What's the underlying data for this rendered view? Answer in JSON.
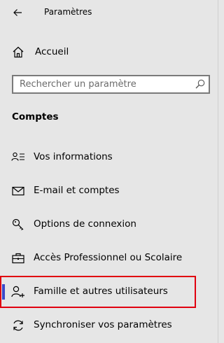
{
  "window": {
    "title": "Paramètres"
  },
  "nav": {
    "home_label": "Accueil"
  },
  "search": {
    "placeholder": "Rechercher un paramètre",
    "value": ""
  },
  "section": {
    "title": "Comptes"
  },
  "menu": {
    "items": [
      {
        "label": "Vos informations",
        "icon": "person-details-icon"
      },
      {
        "label": "E-mail et comptes",
        "icon": "mail-icon"
      },
      {
        "label": "Options de connexion",
        "icon": "key-icon"
      },
      {
        "label": "Accès Professionnel ou Scolaire",
        "icon": "briefcase-icon"
      },
      {
        "label": "Famille et autres utilisateurs",
        "icon": "add-person-icon",
        "selected": true
      },
      {
        "label": "Synchroniser vos paramètres",
        "icon": "sync-icon"
      }
    ]
  },
  "colors": {
    "background": "#e6e6e6",
    "accent": "#3b49c9",
    "highlight": "#e0000f"
  }
}
